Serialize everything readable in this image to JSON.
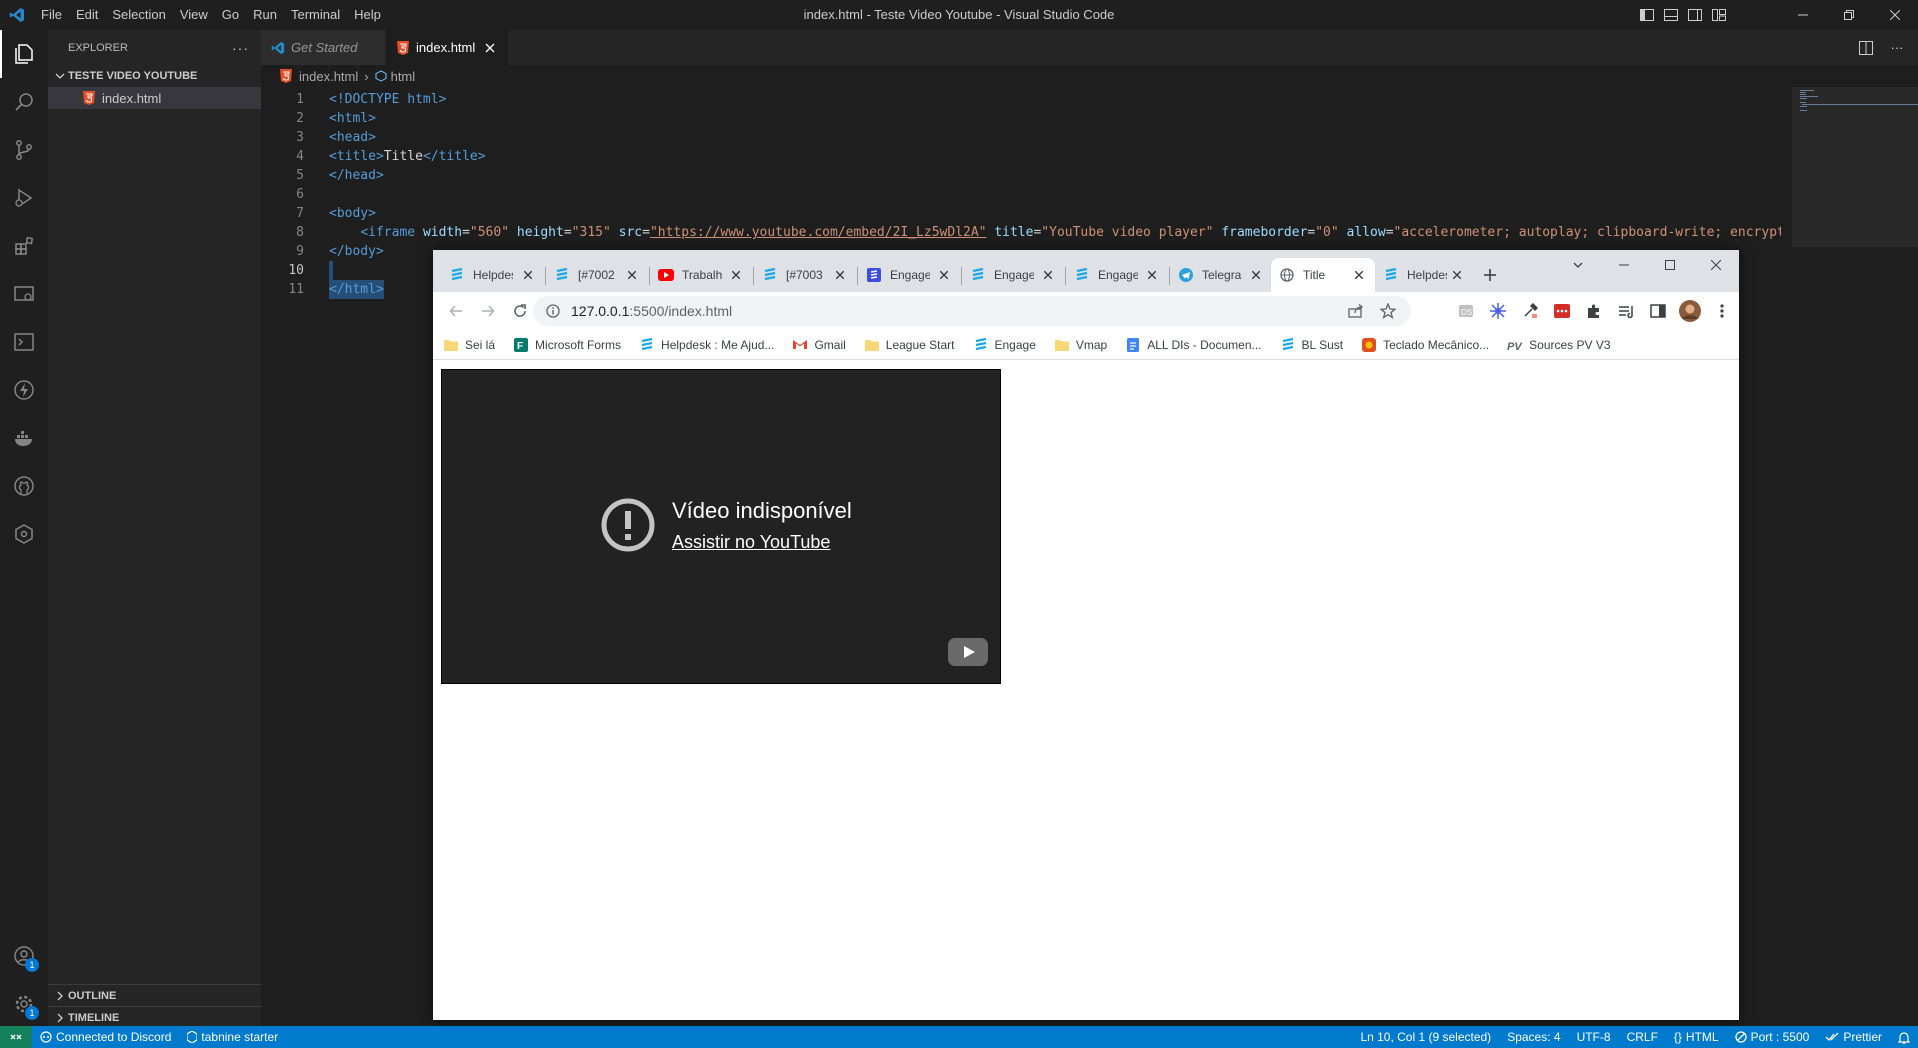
{
  "titlebar": {
    "menu": [
      "File",
      "Edit",
      "Selection",
      "View",
      "Go",
      "Run",
      "Terminal",
      "Help"
    ],
    "title": "index.html - Teste Video Youtube - Visual Studio Code"
  },
  "sidebar": {
    "header": "EXPLORER",
    "folder": "TESTE VIDEO YOUTUBE",
    "file": "index.html",
    "outline": "OUTLINE",
    "timeline": "TIMELINE"
  },
  "editor": {
    "tabs": [
      {
        "label": "Get Started"
      },
      {
        "label": "index.html"
      }
    ],
    "breadcrumb": {
      "file": "index.html",
      "symbol": "html"
    },
    "line_numbers": [
      "1",
      "2",
      "3",
      "4",
      "5",
      "6",
      "7",
      "8",
      "9",
      "10",
      "11"
    ],
    "lines": {
      "l1_doctype": "<!DOCTYPE html>",
      "l2": "<html>",
      "l3": "<head>",
      "l4_open": "<title>",
      "l4_text": "Title",
      "l4_close": "</title>",
      "l5": "</head>",
      "l7": "<body>",
      "l8_tag": "<iframe",
      "l8_a1": "width",
      "l8_v1": "\"560\"",
      "l8_a2": "height",
      "l8_v2": "\"315\"",
      "l8_a3": "src",
      "l8_v3": "\"https://www.youtube.com/embed/2I_Lz5wDl2A\"",
      "l8_a4": "title",
      "l8_v4": "\"YouTube video player\"",
      "l8_a5": "frameborder",
      "l8_v5": "\"0\"",
      "l8_a6": "allow",
      "l8_v6": "\"accelerometer; autoplay; clipboard-write; encrypted-",
      "l9": "</body>",
      "l11": "</html>"
    }
  },
  "statusbar": {
    "discord": "Connected to Discord",
    "tabnine": "tabnine starter",
    "position": "Ln 10, Col 1 (9 selected)",
    "spaces": "Spaces: 4",
    "encoding": "UTF-8",
    "eol": "CRLF",
    "language": "HTML",
    "port": "Port : 5500",
    "prettier": "Prettier"
  },
  "browser": {
    "tabs": [
      {
        "label": "Helpdesk",
        "icon": "engage-icon"
      },
      {
        "label": "[#7002",
        "icon": "engage-icon"
      },
      {
        "label": "Trabalho",
        "icon": "youtube-icon"
      },
      {
        "label": "[#7003",
        "icon": "engage-icon"
      },
      {
        "label": "Engage",
        "icon": "engage-blue-icon"
      },
      {
        "label": "Engage",
        "icon": "engage-icon"
      },
      {
        "label": "Engage",
        "icon": "engage-icon"
      },
      {
        "label": "Telegram",
        "icon": "telegram-icon"
      },
      {
        "label": "Title",
        "icon": "globe-icon"
      },
      {
        "label": "Helpdesk",
        "icon": "engage-icon"
      }
    ],
    "url_host": "127.0.0.1",
    "url_path": ":5500/index.html",
    "bookmarks": [
      {
        "label": "Sei lá",
        "icon": "folder-icon"
      },
      {
        "label": "Microsoft Forms",
        "icon": "forms-icon"
      },
      {
        "label": "Helpdesk : Me Ajud...",
        "icon": "engage-icon"
      },
      {
        "label": "Gmail",
        "icon": "gmail-icon"
      },
      {
        "label": "League Start",
        "icon": "folder-icon"
      },
      {
        "label": "Engage",
        "icon": "engage-icon"
      },
      {
        "label": "Vmap",
        "icon": "folder-icon"
      },
      {
        "label": "ALL DIs - Documen...",
        "icon": "docs-icon"
      },
      {
        "label": "BL Sust",
        "icon": "engage-icon"
      },
      {
        "label": "Teclado Mecânico...",
        "icon": "shop-icon"
      },
      {
        "label": "Sources PV V3",
        "icon": "pv-icon"
      }
    ],
    "video": {
      "title": "Vídeo indisponível",
      "link": "Assistir no YouTube"
    }
  }
}
